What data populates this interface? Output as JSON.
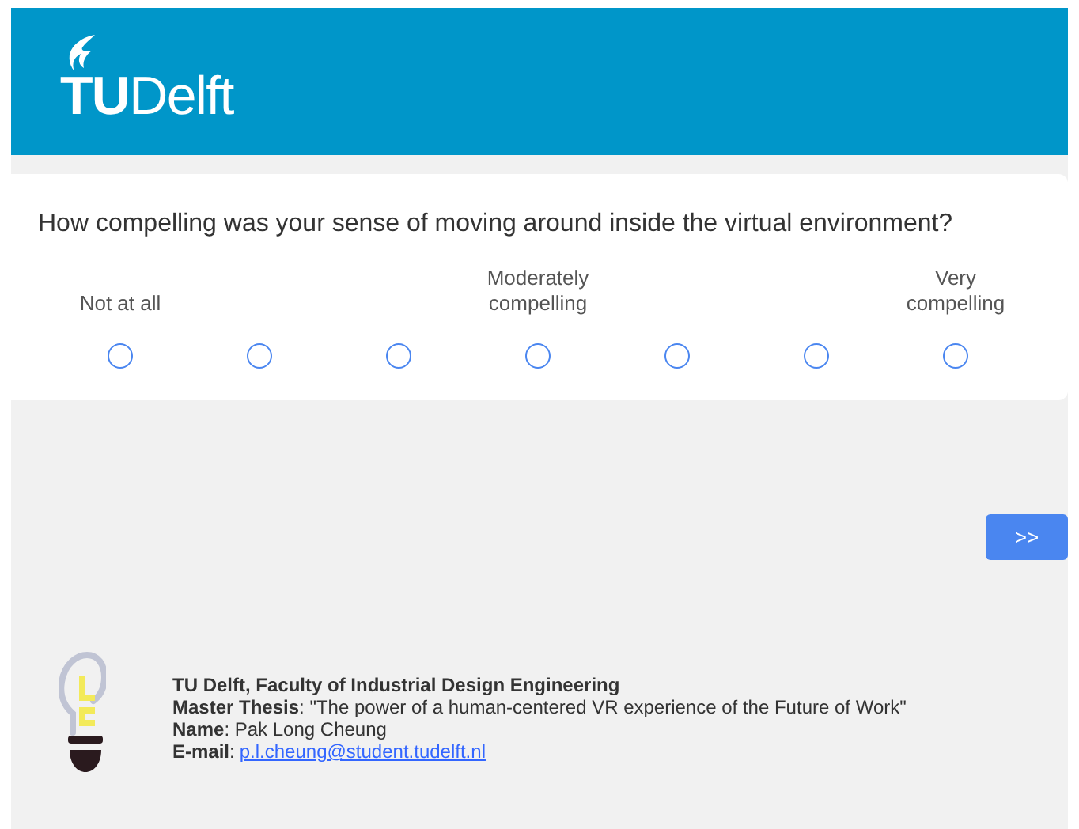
{
  "header": {
    "logo_bold": "TU",
    "logo_text": "Delft"
  },
  "question": {
    "text": "How compelling was your sense of moving around inside the virtual environment?",
    "options": [
      {
        "label": "Not at all",
        "selected": false
      },
      {
        "selected": false
      },
      {
        "selected": false
      },
      {
        "label": "Moderately compelling",
        "selected": false
      },
      {
        "selected": false
      },
      {
        "selected": false
      },
      {
        "label": "Very compelling",
        "selected": false
      }
    ]
  },
  "next_button": ">>",
  "footer": {
    "title": "TU Delft, Faculty of Industrial Design Engineering",
    "thesis": "**Master Thesis**: \"The power of a human-centered VR experience of the Future of Work\"",
    "name": "**Name**: Pak Long Cheung",
    "email_label": "**E-mail**:",
    "email": "p.l.cheung@student.tudelft.nl"
  }
}
